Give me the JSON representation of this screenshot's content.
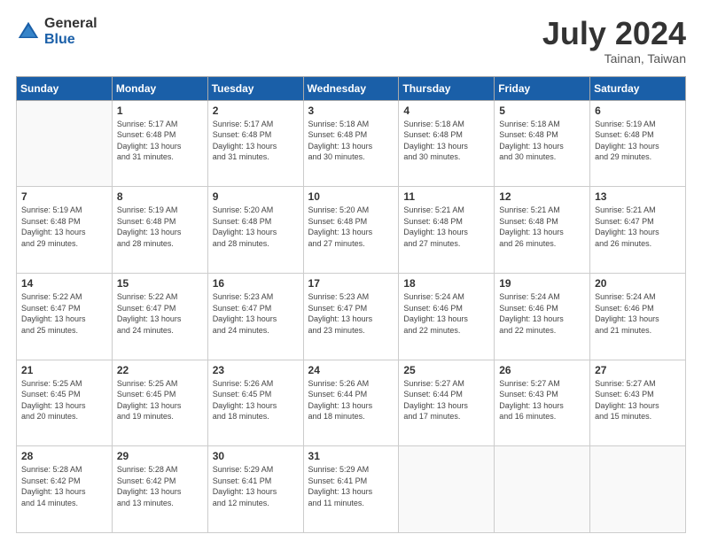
{
  "logo": {
    "general": "General",
    "blue": "Blue"
  },
  "header": {
    "month": "July 2024",
    "location": "Tainan, Taiwan"
  },
  "days_of_week": [
    "Sunday",
    "Monday",
    "Tuesday",
    "Wednesday",
    "Thursday",
    "Friday",
    "Saturday"
  ],
  "weeks": [
    [
      {
        "day": "",
        "info": ""
      },
      {
        "day": "1",
        "info": "Sunrise: 5:17 AM\nSunset: 6:48 PM\nDaylight: 13 hours\nand 31 minutes."
      },
      {
        "day": "2",
        "info": "Sunrise: 5:17 AM\nSunset: 6:48 PM\nDaylight: 13 hours\nand 31 minutes."
      },
      {
        "day": "3",
        "info": "Sunrise: 5:18 AM\nSunset: 6:48 PM\nDaylight: 13 hours\nand 30 minutes."
      },
      {
        "day": "4",
        "info": "Sunrise: 5:18 AM\nSunset: 6:48 PM\nDaylight: 13 hours\nand 30 minutes."
      },
      {
        "day": "5",
        "info": "Sunrise: 5:18 AM\nSunset: 6:48 PM\nDaylight: 13 hours\nand 30 minutes."
      },
      {
        "day": "6",
        "info": "Sunrise: 5:19 AM\nSunset: 6:48 PM\nDaylight: 13 hours\nand 29 minutes."
      }
    ],
    [
      {
        "day": "7",
        "info": "Sunrise: 5:19 AM\nSunset: 6:48 PM\nDaylight: 13 hours\nand 29 minutes."
      },
      {
        "day": "8",
        "info": "Sunrise: 5:19 AM\nSunset: 6:48 PM\nDaylight: 13 hours\nand 28 minutes."
      },
      {
        "day": "9",
        "info": "Sunrise: 5:20 AM\nSunset: 6:48 PM\nDaylight: 13 hours\nand 28 minutes."
      },
      {
        "day": "10",
        "info": "Sunrise: 5:20 AM\nSunset: 6:48 PM\nDaylight: 13 hours\nand 27 minutes."
      },
      {
        "day": "11",
        "info": "Sunrise: 5:21 AM\nSunset: 6:48 PM\nDaylight: 13 hours\nand 27 minutes."
      },
      {
        "day": "12",
        "info": "Sunrise: 5:21 AM\nSunset: 6:48 PM\nDaylight: 13 hours\nand 26 minutes."
      },
      {
        "day": "13",
        "info": "Sunrise: 5:21 AM\nSunset: 6:47 PM\nDaylight: 13 hours\nand 26 minutes."
      }
    ],
    [
      {
        "day": "14",
        "info": "Sunrise: 5:22 AM\nSunset: 6:47 PM\nDaylight: 13 hours\nand 25 minutes."
      },
      {
        "day": "15",
        "info": "Sunrise: 5:22 AM\nSunset: 6:47 PM\nDaylight: 13 hours\nand 24 minutes."
      },
      {
        "day": "16",
        "info": "Sunrise: 5:23 AM\nSunset: 6:47 PM\nDaylight: 13 hours\nand 24 minutes."
      },
      {
        "day": "17",
        "info": "Sunrise: 5:23 AM\nSunset: 6:47 PM\nDaylight: 13 hours\nand 23 minutes."
      },
      {
        "day": "18",
        "info": "Sunrise: 5:24 AM\nSunset: 6:46 PM\nDaylight: 13 hours\nand 22 minutes."
      },
      {
        "day": "19",
        "info": "Sunrise: 5:24 AM\nSunset: 6:46 PM\nDaylight: 13 hours\nand 22 minutes."
      },
      {
        "day": "20",
        "info": "Sunrise: 5:24 AM\nSunset: 6:46 PM\nDaylight: 13 hours\nand 21 minutes."
      }
    ],
    [
      {
        "day": "21",
        "info": "Sunrise: 5:25 AM\nSunset: 6:45 PM\nDaylight: 13 hours\nand 20 minutes."
      },
      {
        "day": "22",
        "info": "Sunrise: 5:25 AM\nSunset: 6:45 PM\nDaylight: 13 hours\nand 19 minutes."
      },
      {
        "day": "23",
        "info": "Sunrise: 5:26 AM\nSunset: 6:45 PM\nDaylight: 13 hours\nand 18 minutes."
      },
      {
        "day": "24",
        "info": "Sunrise: 5:26 AM\nSunset: 6:44 PM\nDaylight: 13 hours\nand 18 minutes."
      },
      {
        "day": "25",
        "info": "Sunrise: 5:27 AM\nSunset: 6:44 PM\nDaylight: 13 hours\nand 17 minutes."
      },
      {
        "day": "26",
        "info": "Sunrise: 5:27 AM\nSunset: 6:43 PM\nDaylight: 13 hours\nand 16 minutes."
      },
      {
        "day": "27",
        "info": "Sunrise: 5:27 AM\nSunset: 6:43 PM\nDaylight: 13 hours\nand 15 minutes."
      }
    ],
    [
      {
        "day": "28",
        "info": "Sunrise: 5:28 AM\nSunset: 6:42 PM\nDaylight: 13 hours\nand 14 minutes."
      },
      {
        "day": "29",
        "info": "Sunrise: 5:28 AM\nSunset: 6:42 PM\nDaylight: 13 hours\nand 13 minutes."
      },
      {
        "day": "30",
        "info": "Sunrise: 5:29 AM\nSunset: 6:41 PM\nDaylight: 13 hours\nand 12 minutes."
      },
      {
        "day": "31",
        "info": "Sunrise: 5:29 AM\nSunset: 6:41 PM\nDaylight: 13 hours\nand 11 minutes."
      },
      {
        "day": "",
        "info": ""
      },
      {
        "day": "",
        "info": ""
      },
      {
        "day": "",
        "info": ""
      }
    ]
  ]
}
